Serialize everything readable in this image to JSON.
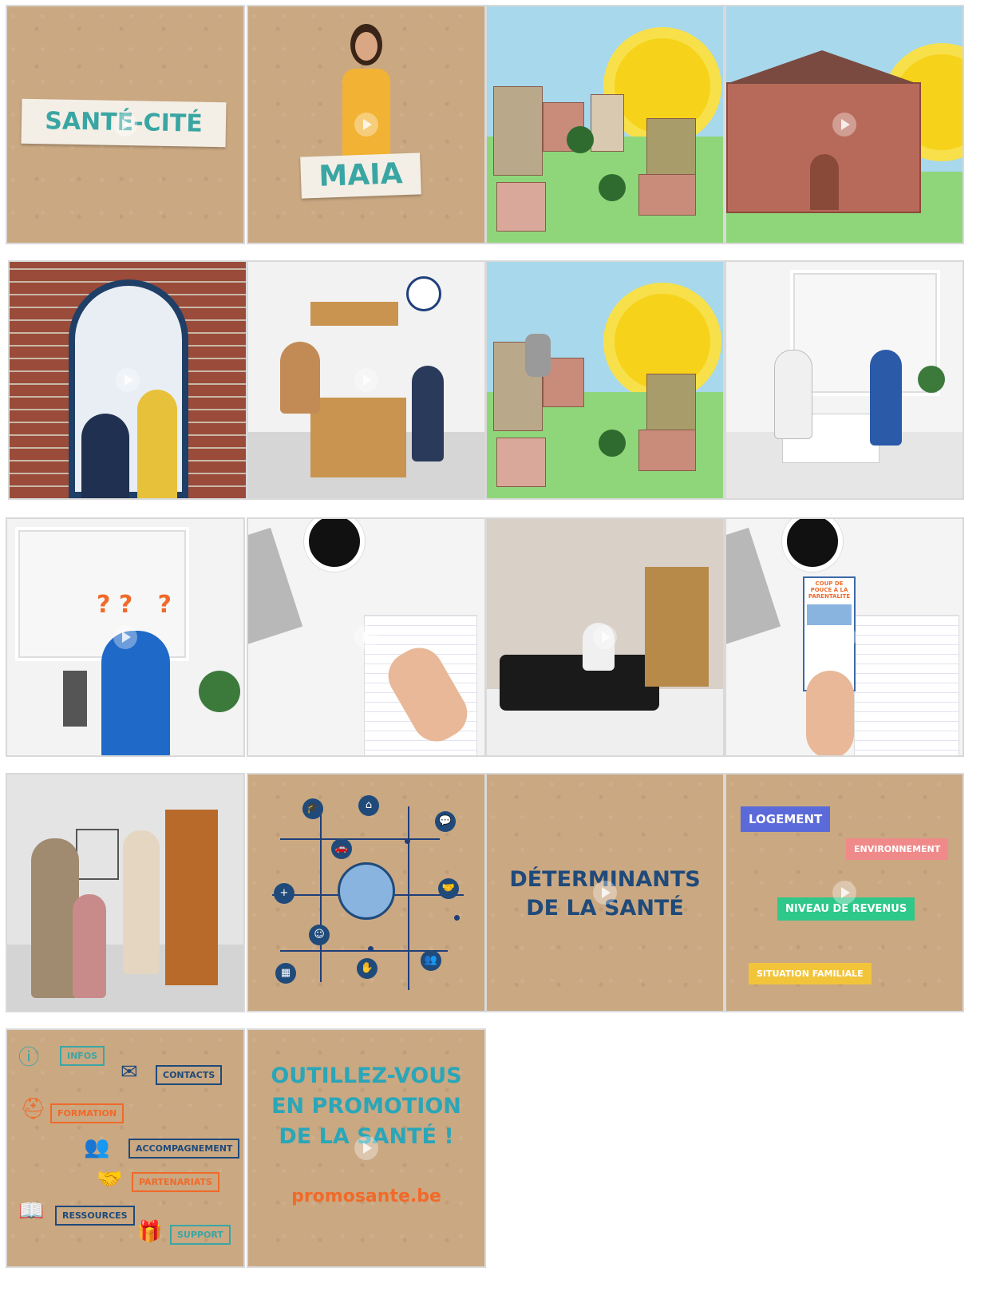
{
  "tiles": {
    "t1": {
      "label": "SANTÉ-CITÉ"
    },
    "t2": {
      "label": "MAIA"
    },
    "t9": {
      "marks": "? ?   ?"
    },
    "t12": {
      "card_text": "COUP DE POUCE À LA PARENTALITÉ"
    },
    "t15": {
      "line1": "DÉTERMINANTS",
      "line2": "DE LA SANTÉ"
    },
    "t16": {
      "tags": [
        "LOGEMENT",
        "ENVIRONNEMENT",
        "NIVEAU DE REVENUS",
        "SITUATION FAMILIALE"
      ]
    },
    "t17": {
      "tags": [
        "INFOS",
        "CONTACTS",
        "FORMATION",
        "ACCOMPAGNEMENT",
        "PARTENARIATS",
        "RESSOURCES",
        "SUPPORT"
      ]
    },
    "t18": {
      "line1": "OUTILLEZ-VOUS",
      "line2": "EN PROMOTION",
      "line3": "DE LA SANTÉ !",
      "url": "promosante.be"
    }
  },
  "colors": {
    "kraft": "#caa882",
    "teal": "#3aa6a4",
    "navy": "#1f4a7a",
    "orange": "#f06a2a"
  }
}
